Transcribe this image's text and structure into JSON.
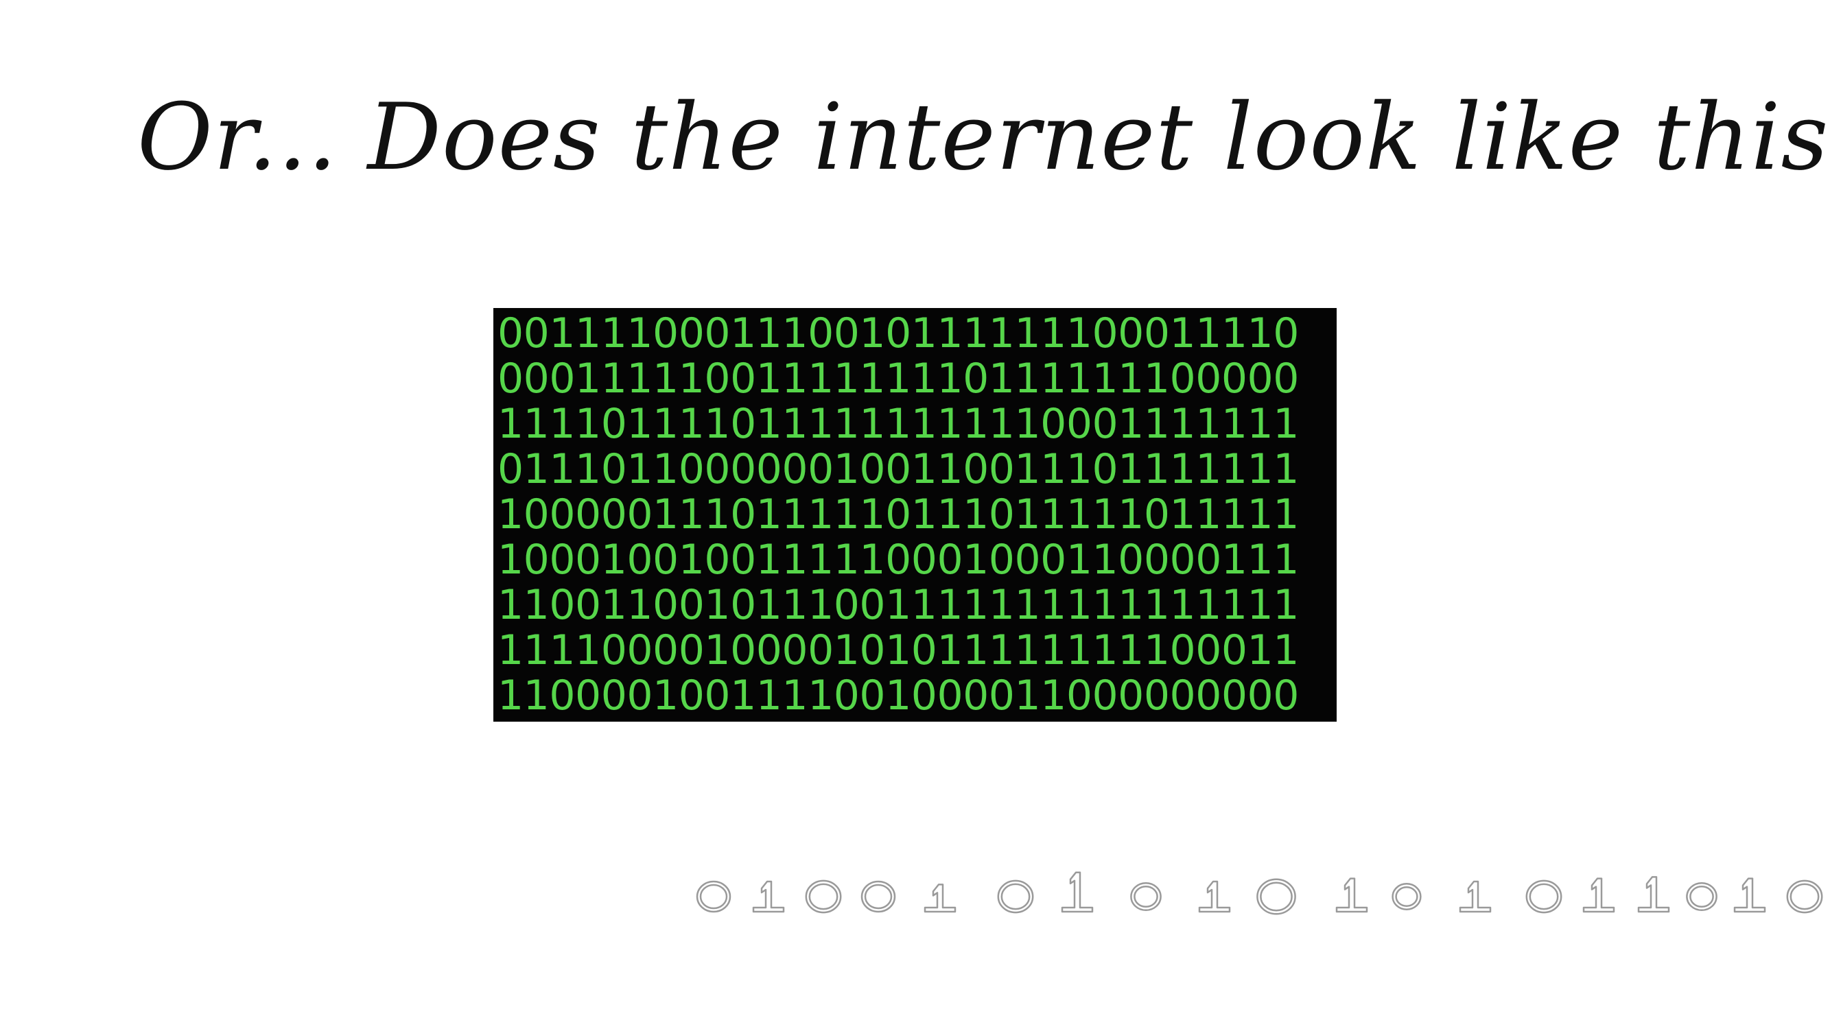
{
  "slide": {
    "title": "Or... Does the internet look like this?"
  },
  "binary_image": {
    "rows": [
      "0011110001110010111111100011110",
      "0001111100111111110111111100000",
      "1111011110111111111110001111111",
      "0111011000000100110011101111111",
      "1000001110111110111011111011111",
      "1000100100111110001000110000111",
      "1100110010111001111111111111111",
      "1111000010000101011111111100011",
      "1100001001111001000011000000000"
    ],
    "digit_color": "#56d64a",
    "background_color": "#050505"
  },
  "sketch_digits": {
    "text": "0100101010101011010",
    "stroke_color": "#9a9a9a"
  }
}
